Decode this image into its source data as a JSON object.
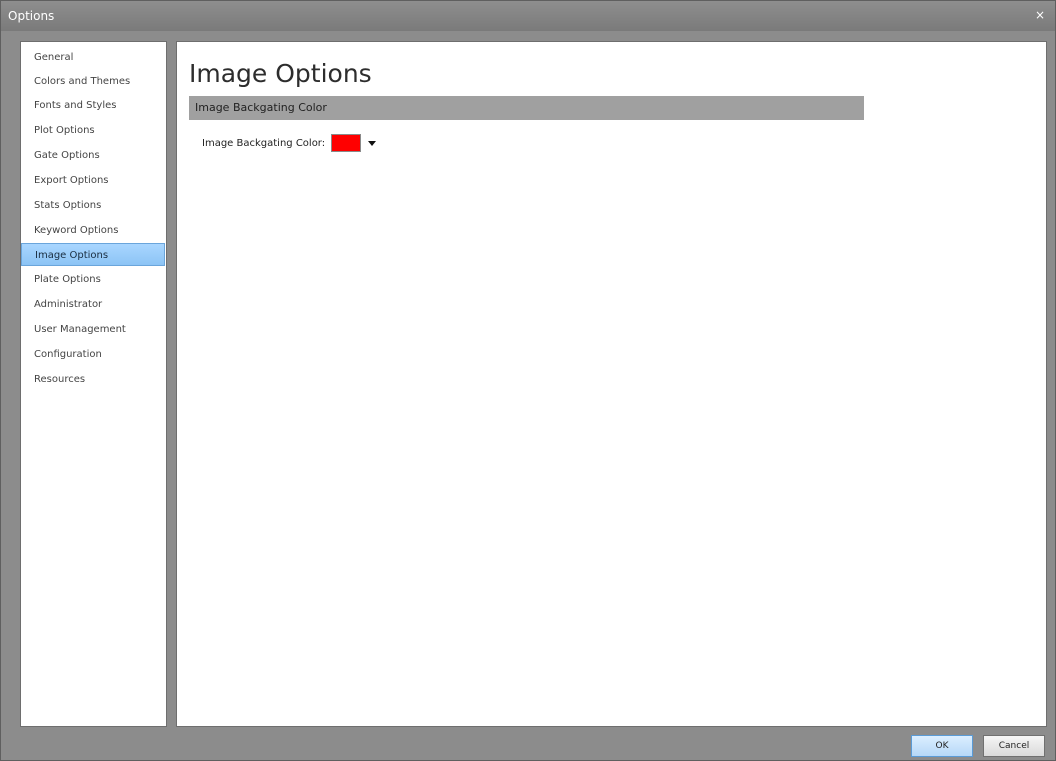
{
  "window": {
    "title": "Options",
    "close_glyph": "×"
  },
  "nav": {
    "items": [
      {
        "label": "General"
      },
      {
        "label": "Colors and Themes"
      },
      {
        "label": "Fonts and Styles"
      },
      {
        "label": "Plot Options"
      },
      {
        "label": "Gate Options"
      },
      {
        "label": "Export Options"
      },
      {
        "label": "Stats Options"
      },
      {
        "label": "Keyword Options"
      },
      {
        "label": "Image Options",
        "selected": true
      },
      {
        "label": "Plate Options"
      },
      {
        "label": "Administrator"
      },
      {
        "label": "User Management"
      },
      {
        "label": "Configuration"
      },
      {
        "label": "Resources"
      }
    ]
  },
  "main": {
    "title": "Image Options",
    "section_title": "Image Backgating Color",
    "field_label": "Image Backgating Color:",
    "selected_color": "#ff0000"
  },
  "buttons": {
    "ok": "OK",
    "cancel": "Cancel"
  },
  "colors": {
    "selection": "#8cc4f5",
    "section_header": "#a0a0a0",
    "frame": "#8c8c8c"
  }
}
